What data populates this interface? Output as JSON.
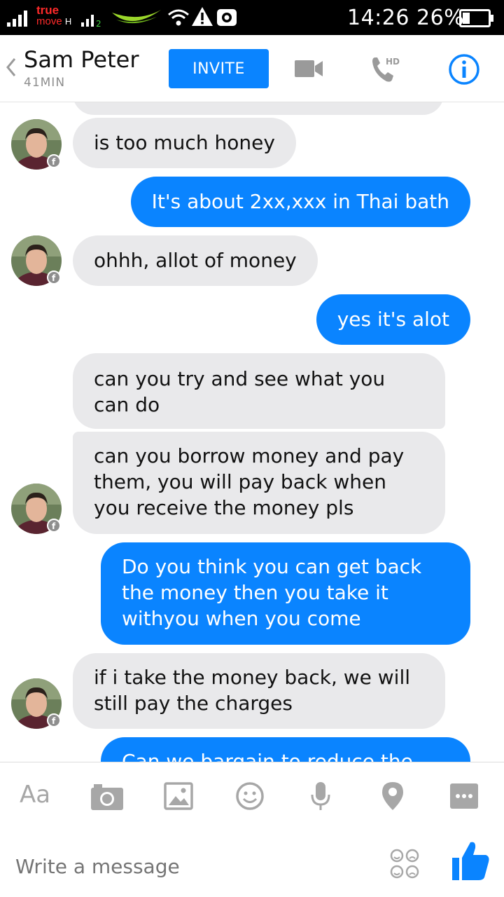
{
  "status_bar": {
    "carrier_line1": "true",
    "carrier_line2": "move",
    "network_type": "H",
    "time": "14:26",
    "battery": "26%"
  },
  "header": {
    "contact_name": "Sam Peter",
    "contact_status": "41MIN",
    "invite_label": "INVITE",
    "call_badge": "HD"
  },
  "messages": [
    {
      "from": "them",
      "text": "is too much honey"
    },
    {
      "from": "me",
      "text": "It's about 2xx,xxx in Thai bath"
    },
    {
      "from": "them",
      "text": "ohhh, allot of money"
    },
    {
      "from": "me",
      "text": "yes it's alot"
    },
    {
      "from": "them",
      "text": "can you try and see what you can do"
    },
    {
      "from": "them",
      "text": "can you borrow money and pay them, you will pay back when you receive the money pls"
    },
    {
      "from": "me",
      "text": "Do you think you can get back the money then you take it withyou when you come"
    },
    {
      "from": "them",
      "text": "if i take the money back, we will still pay the charges"
    },
    {
      "from": "me",
      "text": "Can we bargain to reduce the"
    }
  ],
  "composer": {
    "aa_label": "Aa",
    "placeholder": "Write a message"
  },
  "colors": {
    "accent": "#0a84ff",
    "incoming_bubble": "#e9e9eb",
    "status_bar": "#000000"
  },
  "icons": {
    "camera": "camera-icon",
    "gallery": "image-icon",
    "emoji": "smiley-icon",
    "mic": "microphone-icon",
    "location": "location-pin-icon",
    "more": "more-icon",
    "like": "thumbs-up-icon"
  }
}
